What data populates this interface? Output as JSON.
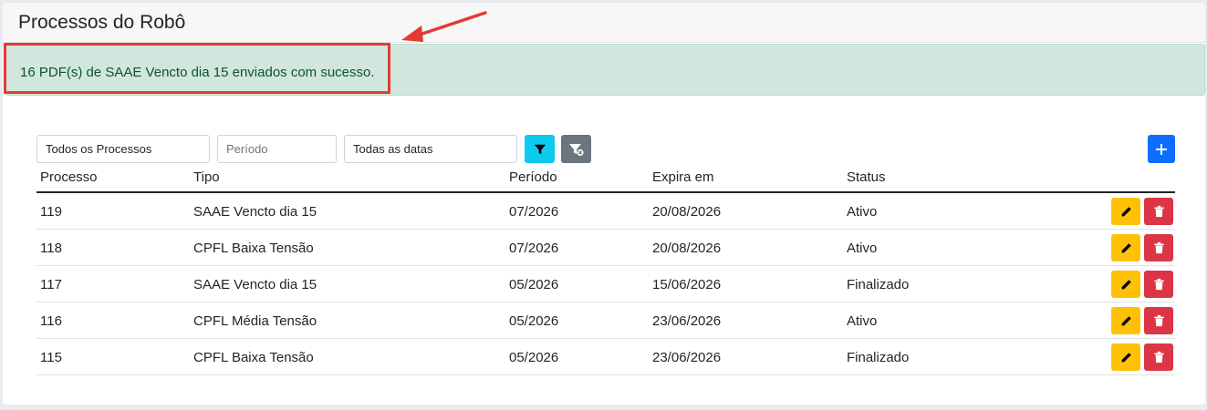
{
  "page_title": "Processos do Robô",
  "alert": {
    "message": "16 PDF(s) de SAAE Vencto dia 15 enviados com sucesso."
  },
  "filters": {
    "process_value": "Todos os Processos",
    "period_placeholder": "Período",
    "dates_value": "Todas as datas"
  },
  "icons": {
    "filter": "funnel-icon",
    "clear_filter": "funnel-clear-icon",
    "add": "plus-icon",
    "edit": "pencil-icon",
    "delete": "trash-icon",
    "annotation": "red-arrow-icon"
  },
  "colors": {
    "alert_bg": "#d1e7dd",
    "alert_text": "#0f5132",
    "filter_btn": "#0dcaf0",
    "clear_btn": "#6c757d",
    "add_btn": "#0d6efd",
    "edit_btn": "#ffc107",
    "delete_btn": "#dc3545",
    "annotation": "#e53935"
  },
  "table": {
    "headers": [
      "Processo",
      "Tipo",
      "Período",
      "Expira em",
      "Status"
    ],
    "rows": [
      {
        "processo": "119",
        "tipo": "SAAE Vencto dia 15",
        "periodo": "07/2026",
        "expira": "20/08/2026",
        "status": "Ativo"
      },
      {
        "processo": "118",
        "tipo": "CPFL Baixa Tensão",
        "periodo": "07/2026",
        "expira": "20/08/2026",
        "status": "Ativo"
      },
      {
        "processo": "117",
        "tipo": "SAAE Vencto dia 15",
        "periodo": "05/2026",
        "expira": "15/06/2026",
        "status": "Finalizado"
      },
      {
        "processo": "116",
        "tipo": "CPFL Média Tensão",
        "periodo": "05/2026",
        "expira": "23/06/2026",
        "status": "Ativo"
      },
      {
        "processo": "115",
        "tipo": "CPFL Baixa Tensão",
        "periodo": "05/2026",
        "expira": "23/06/2026",
        "status": "Finalizado"
      }
    ]
  }
}
